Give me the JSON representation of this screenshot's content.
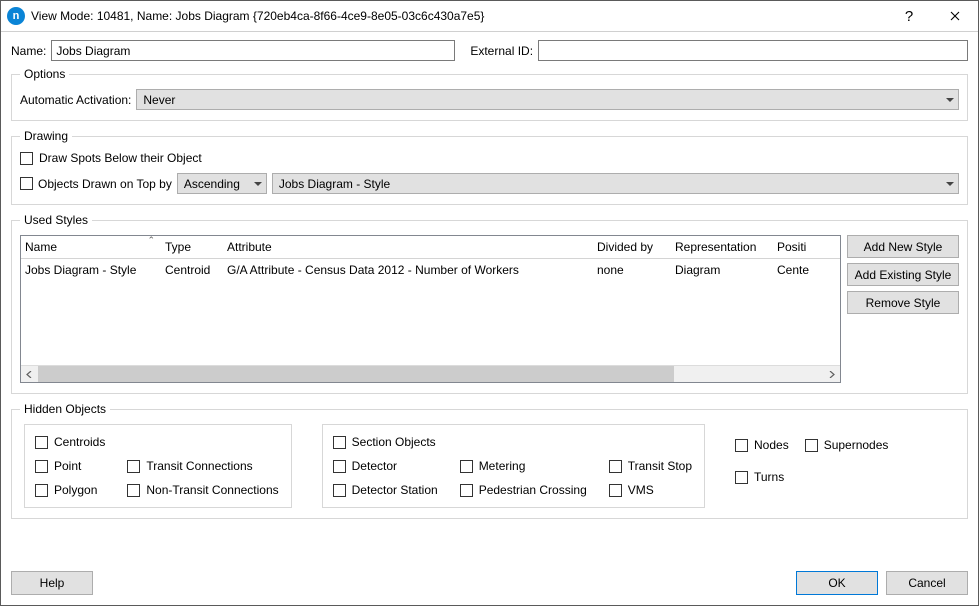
{
  "title": "View Mode: 10481, Name: Jobs Diagram   {720eb4ca-8f66-4ce9-8e05-03c6c430a7e5}",
  "name_label": "Name:",
  "name_value": "Jobs Diagram",
  "external_id_label": "External ID:",
  "external_id_value": "",
  "options": {
    "legend": "Options",
    "auto_activation_label": "Automatic Activation:",
    "auto_activation_value": "Never"
  },
  "drawing": {
    "legend": "Drawing",
    "draw_spots_below": "Draw Spots Below their Object",
    "objects_on_top_by": "Objects Drawn on Top by",
    "order_value": "Ascending",
    "style_value": "Jobs Diagram - Style"
  },
  "used_styles": {
    "legend": "Used Styles",
    "headers": {
      "name": "Name",
      "type": "Type",
      "attribute": "Attribute",
      "divided_by": "Divided by",
      "representation": "Representation",
      "positioning": "Positi"
    },
    "rows": [
      {
        "name": "Jobs Diagram - Style",
        "type": "Centroid",
        "attribute": "G/A Attribute - Census Data 2012 - Number of Workers",
        "divided_by": "none",
        "representation": "Diagram",
        "positioning": "Cente"
      }
    ],
    "buttons": {
      "add_new": "Add New Style",
      "add_existing": "Add Existing Style",
      "remove": "Remove Style"
    }
  },
  "hidden_objects": {
    "legend": "Hidden Objects",
    "centroids": "Centroids",
    "point": "Point",
    "polygon": "Polygon",
    "transit_conn": "Transit Connections",
    "nontransit_conn": "Non-Transit Connections",
    "section_objects": "Section Objects",
    "detector": "Detector",
    "detector_station": "Detector Station",
    "metering": "Metering",
    "pedestrian_crossing": "Pedestrian Crossing",
    "transit_stop": "Transit Stop",
    "vms": "VMS",
    "nodes": "Nodes",
    "turns": "Turns",
    "supernodes": "Supernodes"
  },
  "footer": {
    "help": "Help",
    "ok": "OK",
    "cancel": "Cancel"
  }
}
